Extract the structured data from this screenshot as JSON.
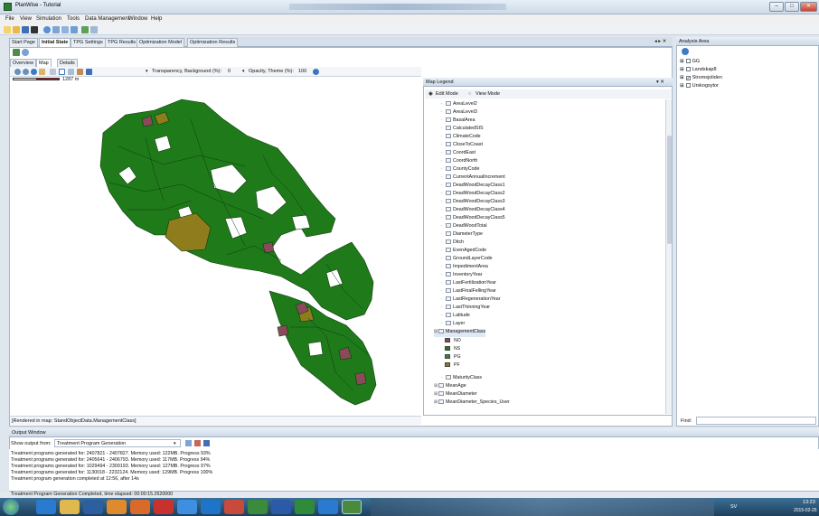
{
  "window": {
    "title": "PlanWise - Tutorial",
    "minimize": "–",
    "maximize": "□",
    "close": "✕"
  },
  "menu": [
    "File",
    "View",
    "Simulation",
    "Tools",
    "Data Management",
    "Window",
    "Help"
  ],
  "doc_tabs": [
    "Start Page",
    "Initial State",
    "TPG Settings",
    "TPG Results",
    "Optimization Model",
    "Optimization Results"
  ],
  "active_doc_tab": "Initial State",
  "pane_controls": "◂ ▸ ✕",
  "sub_tabs": {
    "overview": "Overview",
    "map": "Map",
    "details": "Details"
  },
  "map_toolbar": {
    "transparency_label": "Transparency, Background (%):",
    "transparency_value": "0",
    "opacity_label": "Opacity, Theme (%):",
    "opacity_value": "100"
  },
  "scale_label": "1287 m",
  "map_status": "[Rendered in map: StandObjectData.ManagementClass]",
  "legend": {
    "title": "Map Legend",
    "controls": "▾ ✕",
    "edit_mode": "Edit Mode",
    "view_mode": "View Mode",
    "items": [
      "AreaLevel2",
      "AreaLevel3",
      "BasalArea",
      "CalculatedSIS",
      "ClimateCode",
      "CloseToCoast",
      "CoordEast",
      "CoordNorth",
      "CountyCode",
      "CurrentAnnualIncrement",
      "DeadWoodDecayClass1",
      "DeadWoodDecayClass2",
      "DeadWoodDecayClass3",
      "DeadWoodDecayClass4",
      "DeadWoodDecayClass5",
      "DeadWoodTotal",
      "DiameterType",
      "Ditch",
      "EvenAgedCode",
      "GroundLayerCode",
      "ImpedimentArea",
      "InventoryYear",
      "LastFertilizationYear",
      "LastFinalFellingYear",
      "LastRegenerationYear",
      "LastThinningYear",
      "Latitude",
      "Layer",
      "ManagementClass"
    ],
    "classes": [
      {
        "label": "NO",
        "color": "#8a4a5a"
      },
      {
        "label": "NS",
        "color": "#1e7a1e"
      },
      {
        "label": "PG",
        "color": "#2d8a2d"
      },
      {
        "label": "PF",
        "color": "#8a7a1c"
      }
    ],
    "items_after": [
      "MaturityClass",
      "MeanAge",
      "MeanDiameter",
      "MeanDiameter_Species_User"
    ]
  },
  "analysis_area": {
    "title": "Analysis Area",
    "items": [
      {
        "label": "GG",
        "checked": false
      },
      {
        "label": "Landskap8",
        "checked": false
      },
      {
        "label": "Stromsjoliden",
        "checked": true
      },
      {
        "label": "Urskogsytor",
        "checked": false
      }
    ],
    "find_label": "Find:"
  },
  "output": {
    "title": "Output Window",
    "show_from_label": "Show output from:",
    "source": "Treatment Program Generation",
    "lines": [
      "Treatment programs generated for: 2407821 - 2407827. Memory used: 122MB. Progress 93%",
      "Treatment programs generated for: 2405641 - 2406793. Memory used: 117MB. Progress 94%",
      "Treatment programs generated for: 1029494 - 2309193. Memory used: 127MB. Progress 97%",
      "Treatment programs generated for: 1130018 - 2232124. Memory used: 129MB. Progress 100%",
      "Treatment program generation completed at 12:56, after 14s"
    ]
  },
  "status_bar": "Treatment Program Generation Completed, time elapsed: 00:00:15.2620000",
  "taskbar": {
    "lang": "SV",
    "time": "13:23",
    "date": "2015-02-25"
  },
  "colors": {
    "forest": "#1f7a1a",
    "no_class": "#8a4a5a",
    "pf_class": "#8f7d1d"
  }
}
